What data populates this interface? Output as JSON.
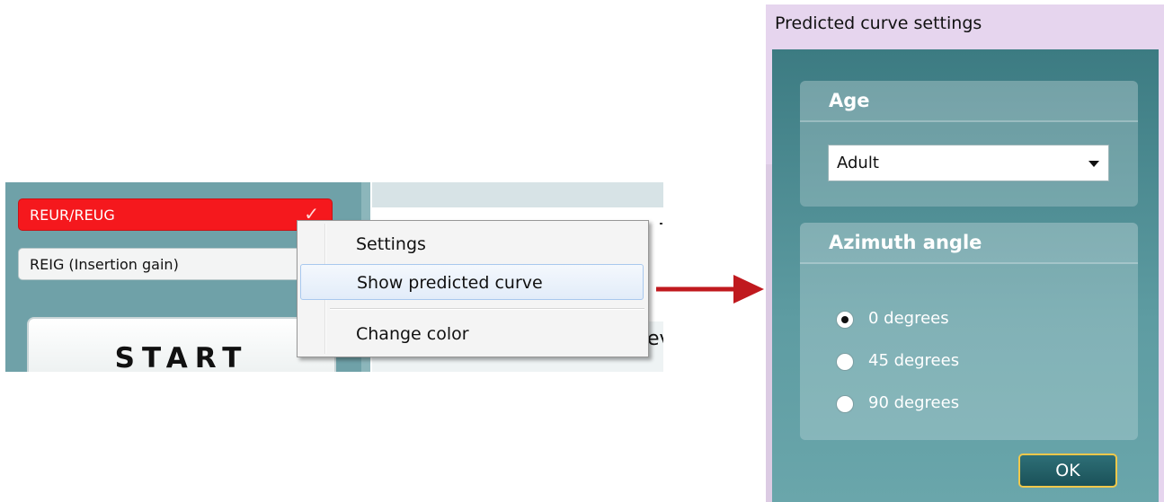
{
  "app": {
    "measurement_rows": [
      {
        "label": "REUR/REUG",
        "checked": true,
        "color": "#f5181d"
      },
      {
        "label": "REIG (Insertion gain)",
        "checked": false
      }
    ],
    "start_label": "START",
    "partial_text": "ev"
  },
  "context_menu": {
    "items": [
      {
        "label": "Settings"
      },
      {
        "label": "Show predicted curve"
      },
      {
        "label": "Change color"
      }
    ],
    "hovered_item": "Show predicted curve"
  },
  "arrow": {
    "color": "#c0191e",
    "icon": "right-arrow-icon"
  },
  "dialog": {
    "title": "Predicted curve settings",
    "age": {
      "label": "Age",
      "selected": "Adult"
    },
    "azimuth": {
      "label": "Azimuth angle",
      "options": [
        {
          "label": "0 degrees",
          "checked": true
        },
        {
          "label": "45 degrees",
          "checked": false
        },
        {
          "label": "90 degrees",
          "checked": false
        }
      ]
    },
    "ok_label": "OK"
  }
}
